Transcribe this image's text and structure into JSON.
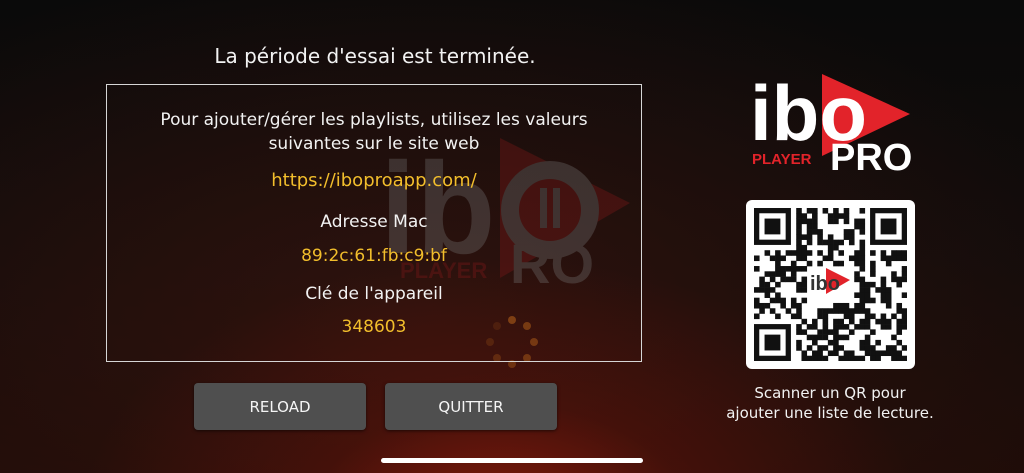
{
  "header": {
    "trial_ended": "La période d'essai est terminée."
  },
  "info": {
    "instructions_line1": "Pour ajouter/gérer les playlists, utilisez les valeurs",
    "instructions_line2": "suivantes sur le site web",
    "website_url": "https://iboproapp.com/",
    "mac_label": "Adresse Mac",
    "mac_value": "89:2c:61:fb:c9:bf",
    "device_key_label": "Clé de l'appareil",
    "device_key_value": "348603"
  },
  "buttons": {
    "reload_label": "RELOAD",
    "quit_label": "QUITTER"
  },
  "brand": {
    "logo_text_main": "ibo",
    "logo_text_player": "PLAYER",
    "logo_text_pro": "PRO",
    "accent_color": "#e2232a"
  },
  "qr": {
    "caption_line1": "Scanner un QR pour",
    "caption_line2": "ajouter une liste de lecture."
  },
  "colors": {
    "highlight": "#f2be2c",
    "button_bg": "#4f4f4f"
  }
}
